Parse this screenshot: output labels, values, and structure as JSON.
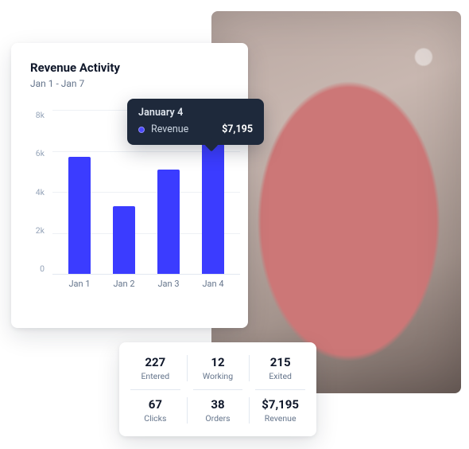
{
  "chart_data": {
    "type": "bar",
    "title": "Revenue Activity",
    "subtitle": "Jan 1 - Jan 7",
    "categories": [
      "Jan 1",
      "Jan 2",
      "Jan 3",
      "Jan 4"
    ],
    "values": [
      5700,
      3300,
      5100,
      7195
    ],
    "y_ticks": [
      "8k",
      "6k",
      "4k",
      "2k",
      "0"
    ],
    "ylim": [
      0,
      8000
    ],
    "xlabel": "",
    "ylabel": "",
    "series_name": "Revenue"
  },
  "tooltip": {
    "title": "January 4",
    "series": "Revenue",
    "value": "$7,195"
  },
  "stats": [
    {
      "value": "227",
      "label": "Entered"
    },
    {
      "value": "12",
      "label": "Working"
    },
    {
      "value": "215",
      "label": "Exited"
    },
    {
      "value": "67",
      "label": "Clicks"
    },
    {
      "value": "38",
      "label": "Orders"
    },
    {
      "value": "$7,195",
      "label": "Revenue"
    }
  ],
  "colors": {
    "bar": "#3b3cff",
    "tooltip_bg": "#1e293b"
  }
}
